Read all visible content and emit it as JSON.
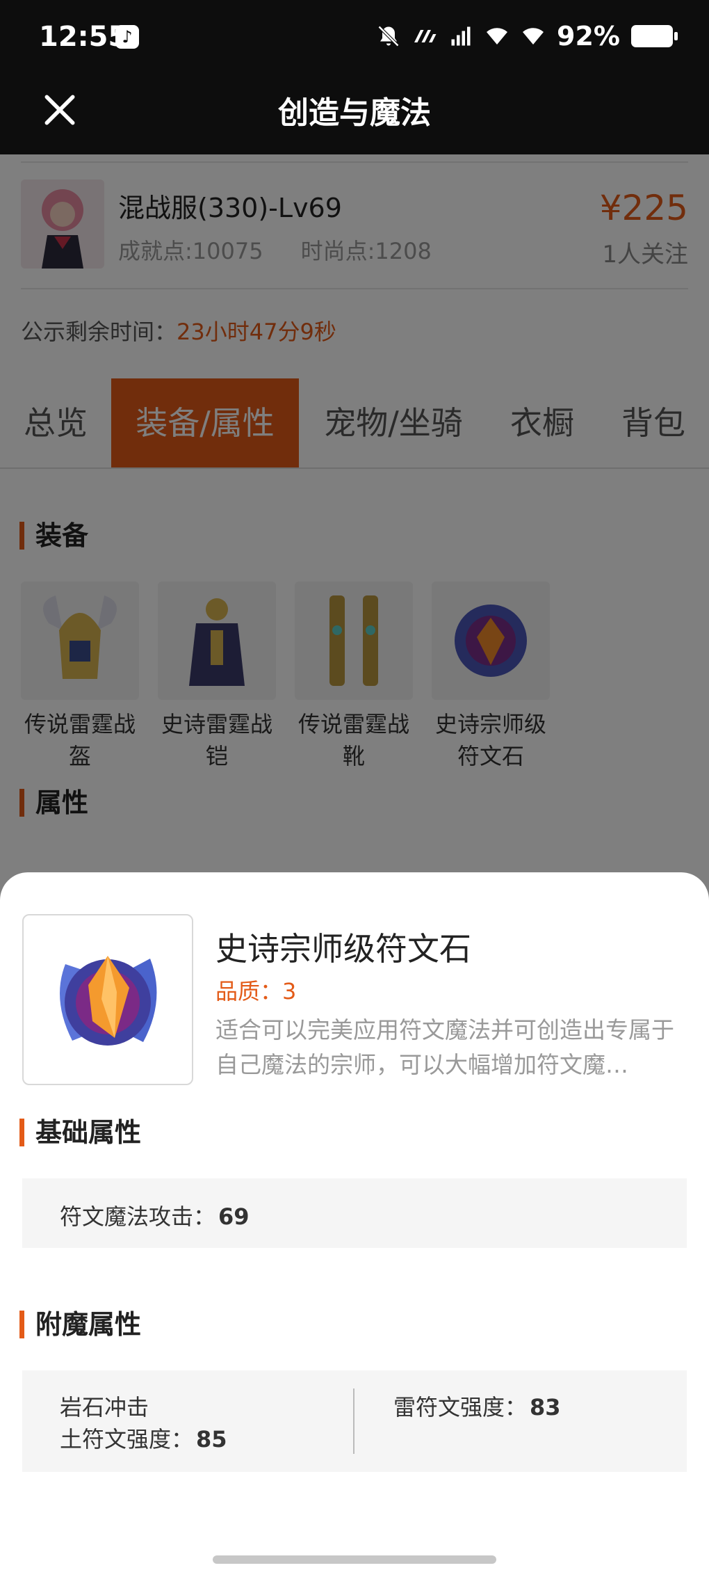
{
  "status_bar": {
    "time": "12:55",
    "battery_pct": "92%"
  },
  "header": {
    "title": "创造与魔法"
  },
  "listing": {
    "server": "混战服(330)-Lv69",
    "achievement": "成就点:10075",
    "fashion": "时尚点:1208",
    "price": "¥225",
    "followers": "1人关注",
    "remaining_label": "公示剩余时间：",
    "remaining_time": "23小时47分9秒"
  },
  "tabs": [
    "总览",
    "装备/属性",
    "宠物/坐骑",
    "衣橱",
    "背包"
  ],
  "active_tab_index": 1,
  "sections": {
    "equipment": "装备",
    "attributes": "属性"
  },
  "equipment": [
    {
      "name": "传说雷霆战盔",
      "icon": "helmet-icon"
    },
    {
      "name": "史诗雷霆战铠",
      "icon": "armor-icon"
    },
    {
      "name": "传说雷霆战靴",
      "icon": "boots-icon"
    },
    {
      "name": "史诗宗师级符文石",
      "icon": "rune-stone-icon"
    }
  ],
  "detail": {
    "name": "史诗宗师级符文石",
    "quality": "品质：3",
    "description": "适合可以完美应用符文魔法并可创造出专属于自己魔法的宗师，可以大幅增加符文魔…",
    "base_title": "基础属性",
    "base_attrs": [
      {
        "label": "符文魔法攻击：",
        "value": "69"
      }
    ],
    "enchant_title": "附魔属性",
    "enchant_name": "岩石冲击",
    "enchant_attrs": [
      {
        "label": "土符文强度：",
        "value": "85"
      },
      {
        "label": "雷符文强度：",
        "value": "83"
      }
    ]
  },
  "colors": {
    "accent": "#e35b18",
    "header_bg": "#0d0d0d"
  }
}
